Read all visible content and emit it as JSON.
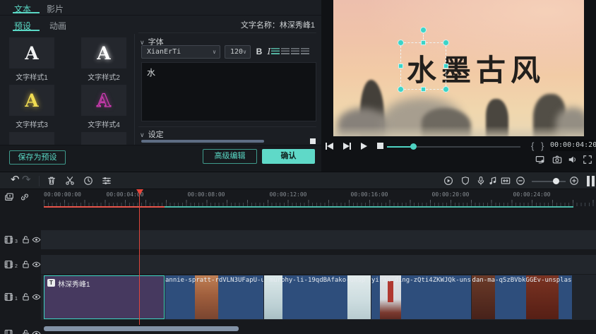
{
  "colors": {
    "accent": "#5ad8c5",
    "playhead": "#e8453a",
    "clip_blue": "#2e4e7c",
    "clip_purple": "#46395f"
  },
  "icons": {
    "chevron_down": "∨",
    "undo": "↶",
    "redo": "↷"
  },
  "text_panel": {
    "tabs": [
      {
        "label": "文本",
        "active": true
      },
      {
        "label": "影片",
        "active": false
      }
    ],
    "subtabs": [
      {
        "label": "预设",
        "active": true
      },
      {
        "label": "动画",
        "active": false
      }
    ],
    "styles": [
      {
        "label": "文字样式1",
        "glyph": "A"
      },
      {
        "label": "文字样式2",
        "glyph": "A"
      },
      {
        "label": "文字样式3",
        "glyph": "A"
      },
      {
        "label": "文字样式4",
        "glyph": "A"
      }
    ],
    "save_preset": "保存为预设",
    "name_label": "文字名称：林深秀峰1",
    "font_section": "字体",
    "font_name": "XianErTi",
    "font_size": "120",
    "bold": "B",
    "italic": "I",
    "content": "水",
    "settings_section": "设定",
    "advanced_edit": "高级编辑",
    "confirm": "确认"
  },
  "preview": {
    "overlay_text": "水墨古风",
    "brace_open": "{",
    "brace_close": "}",
    "timecode": "00:00:04:20"
  },
  "timeline": {
    "ruler_labels": [
      "00:00:00:00",
      "00:00:04:00",
      "00:00:08:00",
      "00:00:12:00",
      "00:00:16:00",
      "00:00:20:00",
      "00:00:24:00"
    ],
    "tracks": [
      {
        "num": "3"
      },
      {
        "num": "2"
      },
      {
        "num": "1"
      }
    ],
    "clips": [
      {
        "name": "林深秀峰1",
        "badge": "T"
      },
      {
        "name": "annie-spratt-rdVLN3UFapU-u"
      },
      {
        "name": "murphy-li-19qdBAfako-unsp"
      },
      {
        "name": "yiran-ding-zQti4ZKWJQk-unsp"
      },
      {
        "name": "dan-ma-qSzBVbkGGEv-unsplas"
      }
    ]
  }
}
